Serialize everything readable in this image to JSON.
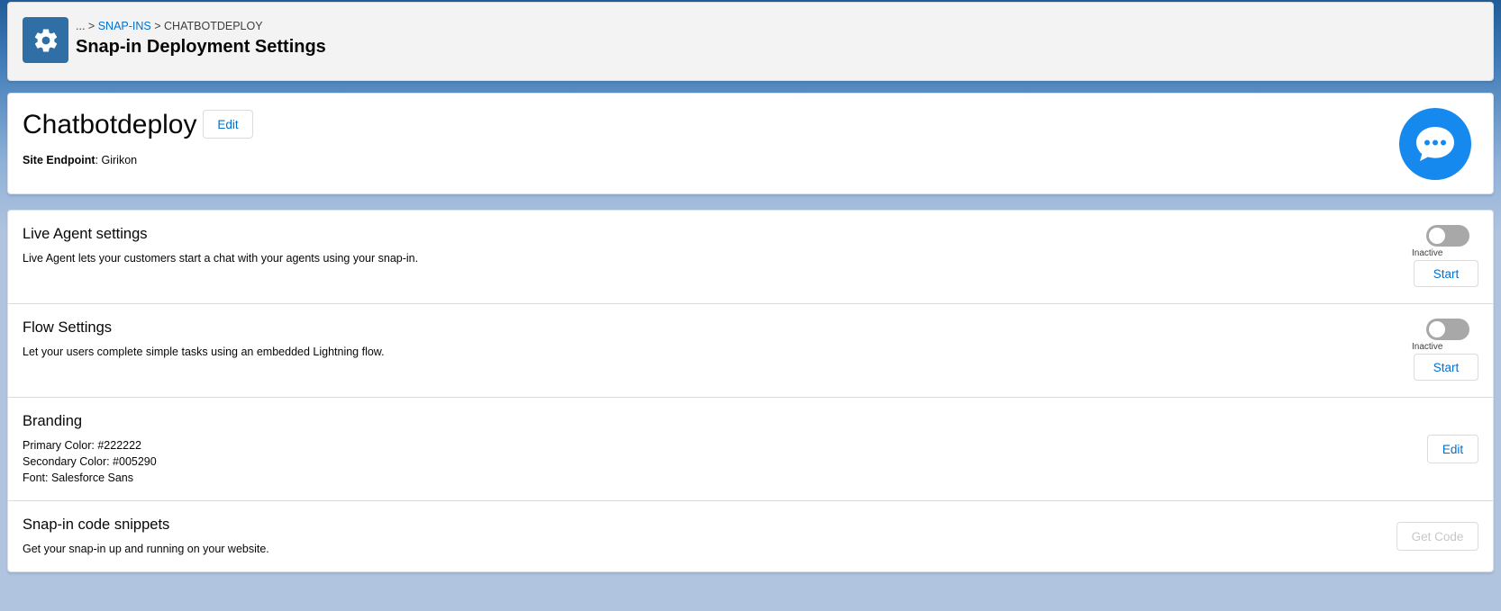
{
  "header": {
    "breadcrumb_ellipsis": "...",
    "breadcrumb_sep1": ">",
    "breadcrumb_link": "SNAP-INS",
    "breadcrumb_sep2": ">",
    "breadcrumb_current": "CHATBOTDEPLOY",
    "title": "Snap-in Deployment Settings",
    "icon": "gear-icon"
  },
  "record": {
    "name": "Chatbotdeploy",
    "edit_label": "Edit",
    "site_endpoint_label": "Site Endpoint",
    "site_endpoint_value": ": Girikon",
    "icon": "chat-bubble-icon",
    "icon_color": "#1589ee"
  },
  "sections": {
    "live_agent": {
      "title": "Live Agent settings",
      "description": "Live Agent lets your customers start a chat with your agents using your snap-in.",
      "status": "Inactive",
      "active": false,
      "button": "Start"
    },
    "flow": {
      "title": "Flow Settings",
      "description": "Let your users complete simple tasks using an embedded Lightning flow.",
      "status": "Inactive",
      "active": false,
      "button": "Start"
    },
    "branding": {
      "title": "Branding",
      "primary_color": "Primary Color: #222222",
      "secondary_color": "Secondary Color: #005290",
      "font": "Font: Salesforce Sans",
      "button": "Edit"
    },
    "code": {
      "title": "Snap-in code snippets",
      "description": "Get your snap-in up and running on your website.",
      "button": "Get Code",
      "button_disabled": true
    }
  },
  "colors": {
    "link": "#0070d2",
    "header_icon_bg": "#2f6fa5"
  }
}
